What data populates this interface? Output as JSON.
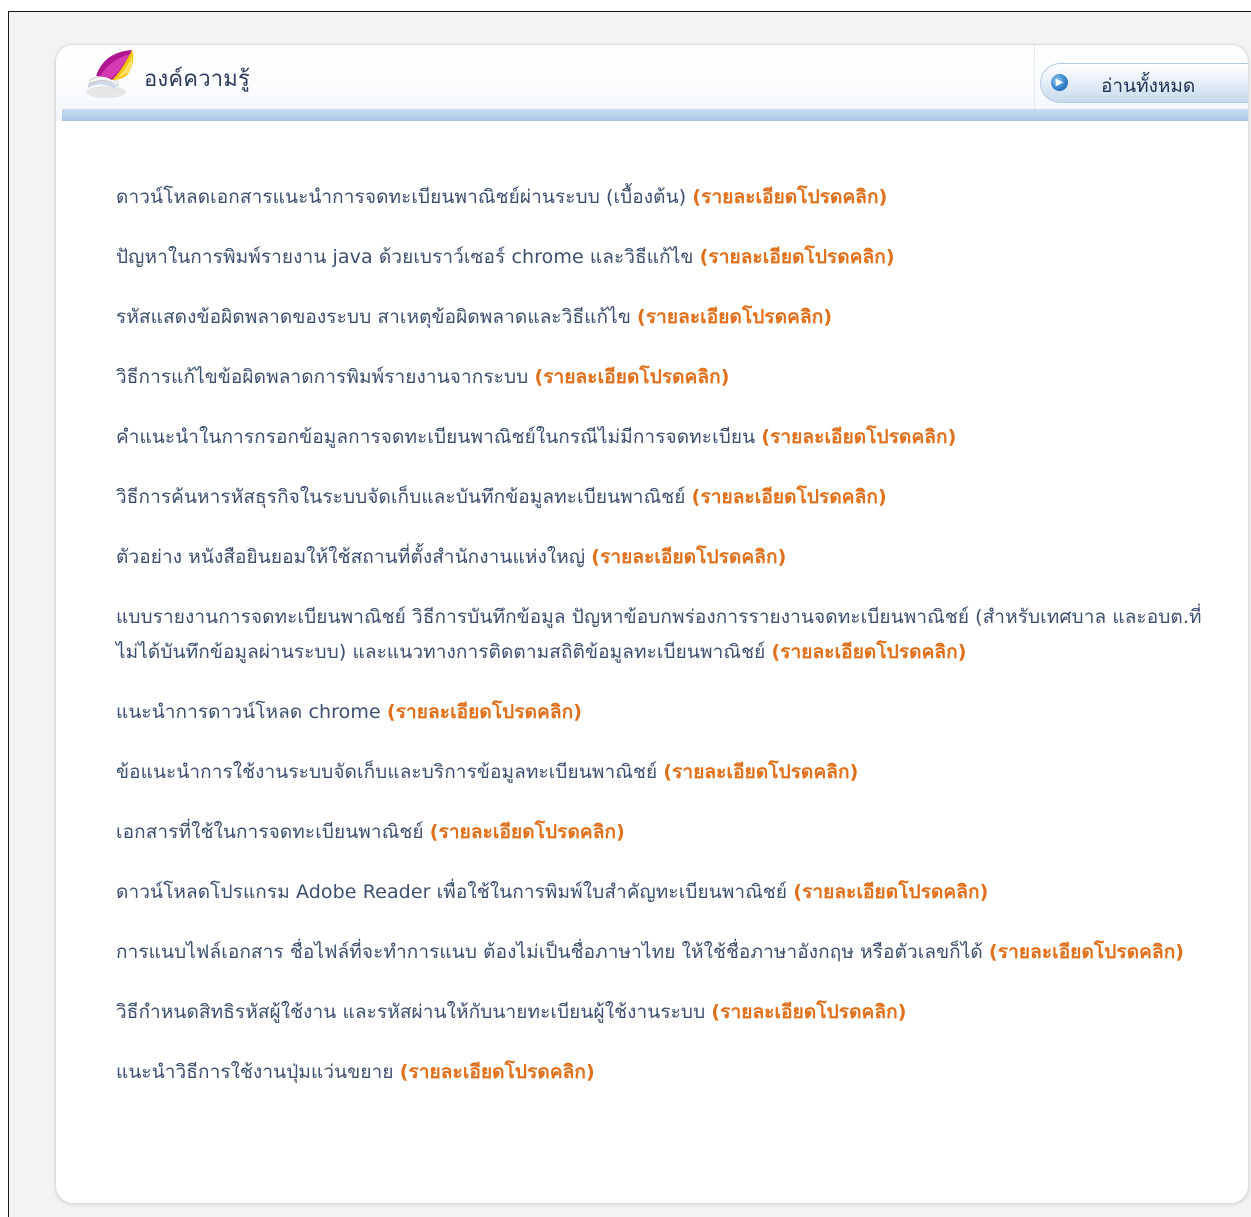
{
  "panel": {
    "title": "องค์ความรู้",
    "read_all_label": "อ่านทั้งหมด",
    "read_all_icon": "play-arrow-icon",
    "logo_icon": "open-book-logo",
    "accent_color": "#e0701b",
    "text_color": "#3c4f6f",
    "header_bar_color": "#a9c6e3"
  },
  "items": [
    {
      "text": "ดาวน์โหลดเอกสารแนะนำการจดทะเบียนพาณิชย์ผ่านระบบ (เบื้องต้น)",
      "detail": "(รายละเอียดโปรดคลิก)"
    },
    {
      "text": "ปัญหาในการพิมพ์รายงาน java ด้วยเบราว์เซอร์ chrome และวิธีแก้ไข",
      "detail": "(รายละเอียดโปรดคลิก)"
    },
    {
      "text": "รหัสแสดงข้อผิดพลาดของระบบ สาเหตุข้อผิดพลาดและวิธีแก้ไข",
      "detail": "(รายละเอียดโปรดคลิก)"
    },
    {
      "text": "วิธีการแก้ไขข้อผิดพลาดการพิมพ์รายงานจากระบบ",
      "detail": "(รายละเอียดโปรดคลิก)"
    },
    {
      "text": "คำแนะนำในการกรอกข้อมูลการจดทะเบียนพาณิชย์ในกรณีไม่มีการจดทะเบียน",
      "detail": "(รายละเอียดโปรดคลิก)"
    },
    {
      "text": "วิธีการค้นหารหัสธุรกิจในระบบจัดเก็บและบันทึกข้อมูลทะเบียนพาณิชย์",
      "detail": "(รายละเอียดโปรดคลิก)"
    },
    {
      "text": "ตัวอย่าง หนังสือยินยอมให้ใช้สถานที่ตั้งสำนักงานแห่งใหญ่",
      "detail": "(รายละเอียดโปรดคลิก)"
    },
    {
      "text": "แบบรายงานการจดทะเบียนพาณิชย์ วิธีการบันทึกข้อมูล ปัญหาข้อบกพร่องการรายงานจดทะเบียนพาณิชย์ (สำหรับเทศบาล และอบต.ที่ไม่ได้บันทึกข้อมูลผ่านระบบ) และแนวทางการติดตามสถิติข้อมูลทะเบียนพาณิชย์",
      "detail": "(รายละเอียดโปรดคลิก)"
    },
    {
      "text": "แนะนำการดาวน์โหลด chrome",
      "detail": "(รายละเอียดโปรดคลิก)"
    },
    {
      "text": "ข้อแนะนำการใช้งานระบบจัดเก็บและบริการข้อมูลทะเบียนพาณิชย์",
      "detail": "(รายละเอียดโปรดคลิก)"
    },
    {
      "text": "เอกสารที่ใช้ในการจดทะเบียนพาณิชย์",
      "detail": "(รายละเอียดโปรดคลิก)"
    },
    {
      "text": "ดาวน์โหลดโปรแกรม Adobe Reader เพื่อใช้ในการพิมพ์ใบสำคัญทะเบียนพาณิชย์",
      "detail": "(รายละเอียดโปรดคลิก)"
    },
    {
      "text": "การแนบไฟล์เอกสาร ชื่อไฟล์ที่จะทำการแนบ ต้องไม่เป็นชื่อภาษาไทย ให้ใช้ชื่อภาษาอังกฤษ หรือตัวเลขก็ได้",
      "detail": "(รายละเอียดโปรดคลิก)"
    },
    {
      "text": "วิธีกำหนดสิทธิรหัสผู้ใช้งาน และรหัสผ่านให้กับนายทะเบียนผู้ใช้งานระบบ",
      "detail": "(รายละเอียดโปรดคลิก)"
    },
    {
      "text": "แนะนำวิธีการใช้งานปุ่มแว่นขยาย",
      "detail": "(รายละเอียดโปรดคลิก)"
    }
  ]
}
